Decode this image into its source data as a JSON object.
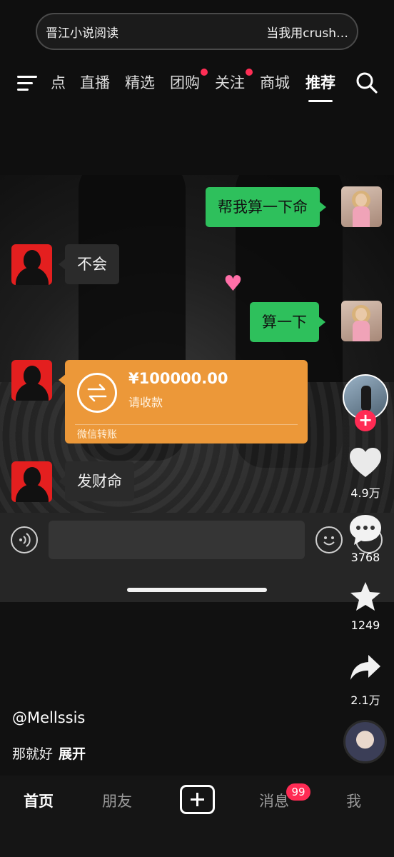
{
  "mini_player": {
    "left_text": "晋江小说阅读",
    "right_text": "当我用crush…"
  },
  "nav": {
    "tabs": [
      "点",
      "直播",
      "精选",
      "团购",
      "关注",
      "商城",
      "推荐"
    ],
    "active_tab": "推荐",
    "dot_tabs": [
      "团购",
      "关注"
    ]
  },
  "chat": {
    "messages": [
      {
        "side": "right",
        "text": "帮我算一下命"
      },
      {
        "side": "left",
        "text": "不会"
      },
      {
        "side": "right",
        "text": "算一下"
      },
      {
        "side": "left",
        "text": "发财命"
      }
    ],
    "transfer": {
      "amount": "¥100000.00",
      "status": "请收款",
      "footer": "微信转账"
    }
  },
  "rail": {
    "likes": "4.9万",
    "comments": "3768",
    "favorites": "1249",
    "shares": "2.1万"
  },
  "post": {
    "author": "@Mellssis",
    "caption": "那就好",
    "expand_label": "展开"
  },
  "bottom_nav": {
    "home": "首页",
    "friends": "朋友",
    "messages": "消息",
    "me": "我",
    "messages_badge": "99"
  },
  "colors": {
    "accent_red": "#ff2b54",
    "wechat_green": "#2ec05c",
    "transfer_orange": "#ec9839"
  }
}
